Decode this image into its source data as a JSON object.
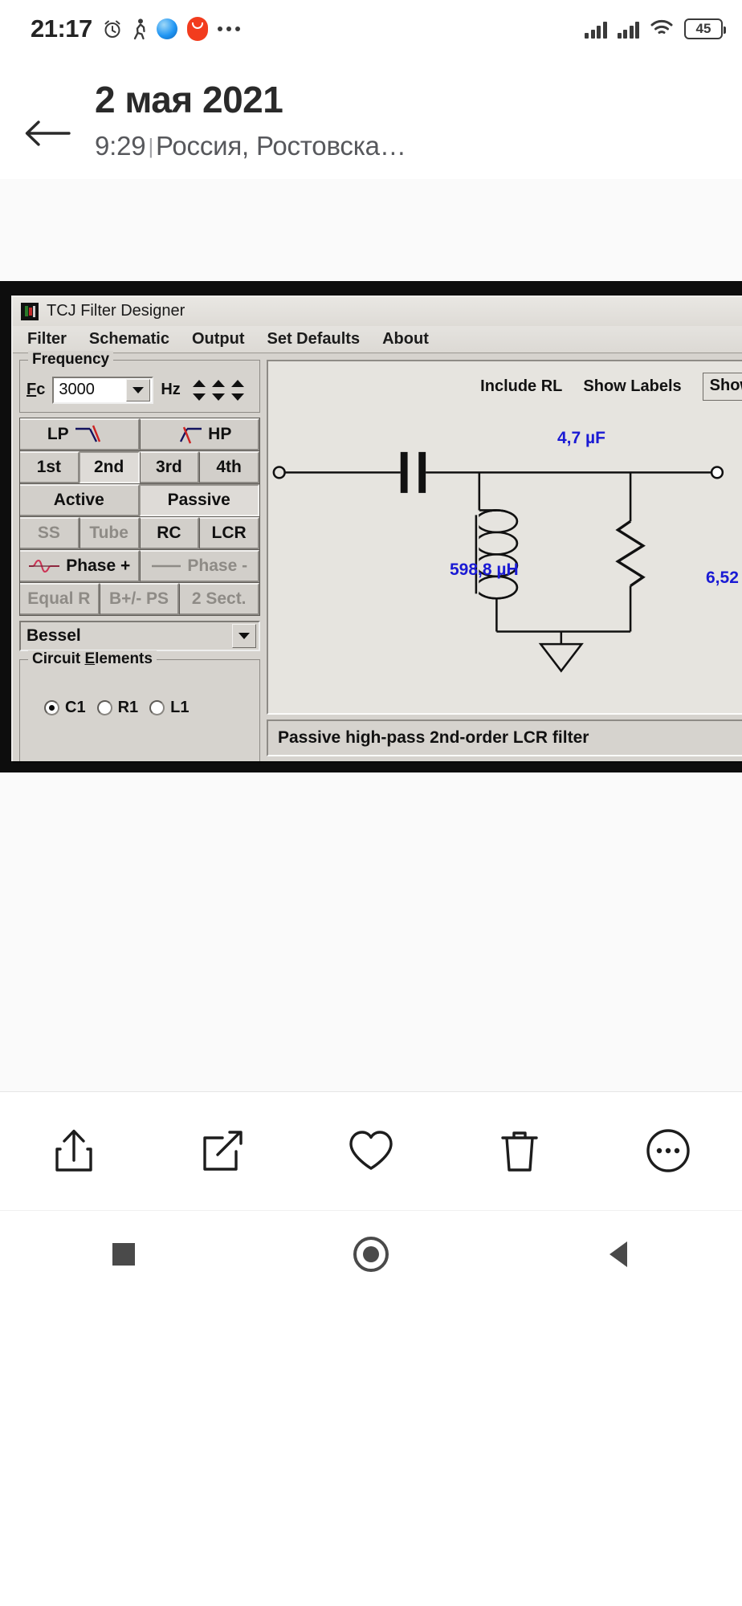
{
  "status_bar": {
    "time": "21:17",
    "battery": "45",
    "icons": [
      "alarm-icon",
      "walking-icon",
      "browser-icon",
      "aliexpress-icon",
      "more-dots-icon",
      "signal-sim1-icon",
      "signal-sim2-icon",
      "wifi-icon",
      "battery-icon"
    ]
  },
  "header": {
    "back_label": "back-arrow",
    "title": "2 мая 2021",
    "time": "9:29",
    "separator": "|",
    "location": "Россия, Ростовска…"
  },
  "app": {
    "window_title": "TCJ Filter Designer",
    "menu": [
      "Filter",
      "Schematic",
      "Output",
      "Set Defaults",
      "About"
    ],
    "frequency": {
      "legend": "Frequency",
      "label": "Fc",
      "value": "3000",
      "unit": "Hz"
    },
    "type_buttons": {
      "row1": [
        {
          "label": "LP",
          "icon": "lowpass-curve-icon",
          "state": "normal"
        },
        {
          "label": "HP",
          "icon": "highpass-curve-icon",
          "state": "normal"
        }
      ],
      "row2": [
        {
          "label": "1st",
          "state": "normal"
        },
        {
          "label": "2nd",
          "state": "selected"
        },
        {
          "label": "3rd",
          "state": "normal"
        },
        {
          "label": "4th",
          "state": "normal"
        }
      ],
      "row3": [
        {
          "label": "Active",
          "state": "normal"
        },
        {
          "label": "Passive",
          "state": "selected"
        }
      ],
      "row4": [
        {
          "label": "SS",
          "state": "disabled"
        },
        {
          "label": "Tube",
          "state": "disabled"
        },
        {
          "label": "RC",
          "state": "normal"
        },
        {
          "label": "LCR",
          "state": "normal"
        }
      ],
      "row5": [
        {
          "label": "Phase +",
          "icon": "sine-wave-icon",
          "state": "normal"
        },
        {
          "label": "Phase -",
          "icon": "flat-line-icon",
          "state": "disabled"
        }
      ],
      "row6": [
        {
          "label": "Equal R",
          "state": "disabled"
        },
        {
          "label": "B+/- PS",
          "state": "disabled"
        },
        {
          "label": "2 Sect.",
          "state": "disabled"
        }
      ]
    },
    "alignment": {
      "selected": "Bessel"
    },
    "circuit_elements": {
      "legend": "Circuit Elements",
      "radios": [
        {
          "label": "C1",
          "checked": true
        },
        {
          "label": "R1",
          "checked": false
        },
        {
          "label": "L1",
          "checked": false
        }
      ],
      "value": "4,7",
      "unit": "µF"
    },
    "schematic": {
      "options": [
        "Include RL",
        "Show Labels",
        "Show"
      ],
      "capacitor_label": "4,7 µF",
      "inductor_label": "598,8 µH",
      "resistor_label": "6,52",
      "accent_color": "#1a1ad4"
    },
    "status_text": "Passive high-pass 2nd-order LCR filter"
  },
  "toolbar": {
    "items": [
      "share-icon",
      "edit-icon",
      "favorite-heart-icon",
      "delete-trash-icon",
      "more-circle-icon"
    ]
  },
  "navbar": {
    "items": [
      "recents-square-icon",
      "home-circle-icon",
      "back-triangle-icon"
    ]
  }
}
